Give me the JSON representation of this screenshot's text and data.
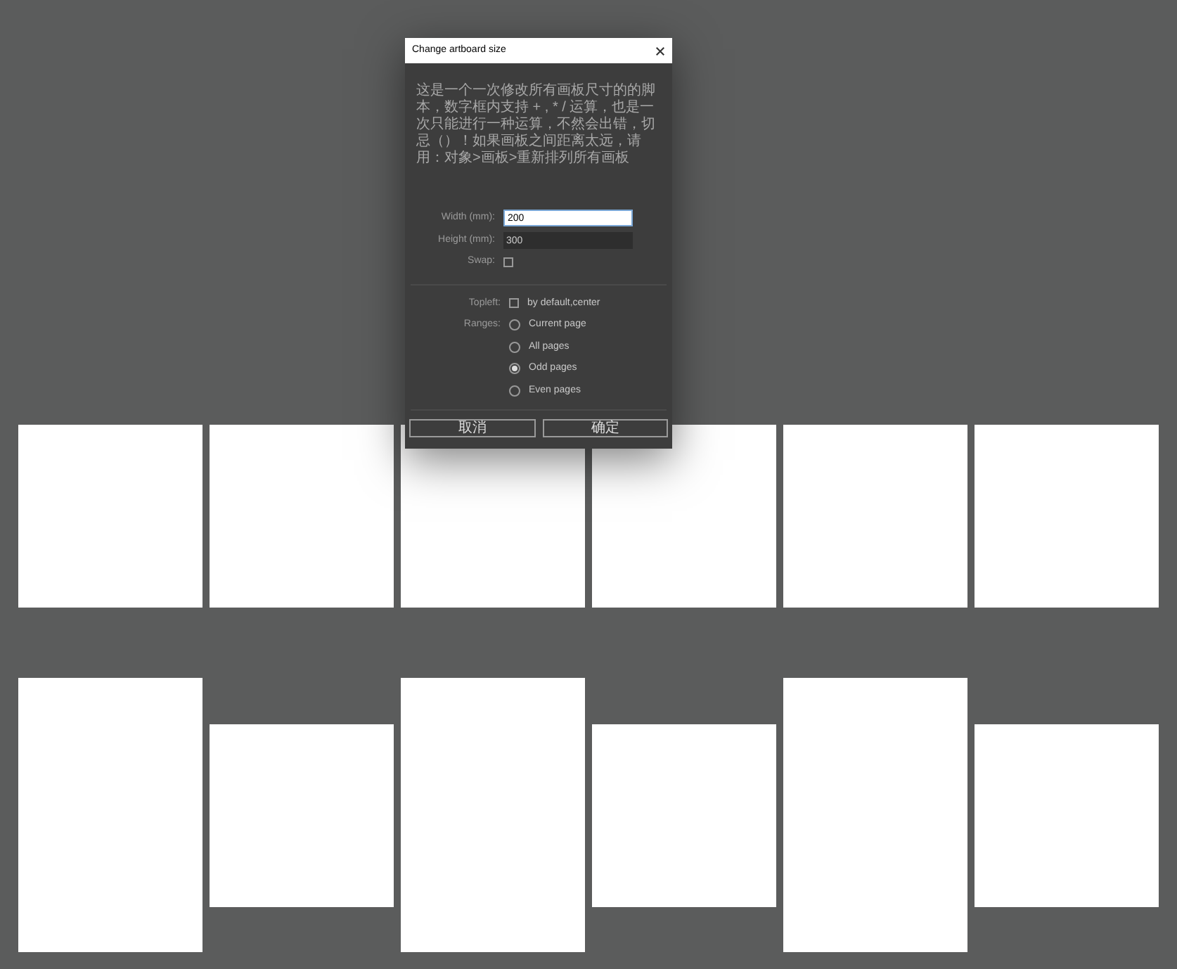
{
  "dialog": {
    "title": "Change artboard size",
    "description": "这是一个一次修改所有画板尺寸的的脚本，数字框内支持 + , * / 运算，也是一次只能进行一种运算，不然会出错，切忌（）！如果画板之间距离太远，请用：对象>画板>重新排列所有画板",
    "width": {
      "label": "Width (mm):",
      "value": "200"
    },
    "height": {
      "label": "Height (mm):",
      "value": "300"
    },
    "swap": {
      "label": "Swap:",
      "checked": false
    },
    "topleft": {
      "label": "Topleft:",
      "option": "by default,center",
      "checked": false
    },
    "ranges": {
      "label": "Ranges:",
      "options": [
        {
          "label": "Current page",
          "selected": false
        },
        {
          "label": "All pages",
          "selected": false
        },
        {
          "label": "Odd pages",
          "selected": true
        },
        {
          "label": "Even pages",
          "selected": false
        }
      ]
    },
    "buttons": [
      "取消",
      "确定"
    ]
  },
  "artboard_rows": [
    {
      "boards": [
        {
          "kind": "square"
        },
        {
          "kind": "square"
        },
        {
          "kind": "square"
        },
        {
          "kind": "square"
        },
        {
          "kind": "square"
        },
        {
          "kind": "square"
        }
      ]
    },
    {
      "boards": [
        {
          "kind": "tall"
        },
        {
          "kind": "wide"
        },
        {
          "kind": "tall"
        },
        {
          "kind": "wide"
        },
        {
          "kind": "tall"
        },
        {
          "kind": "wide"
        }
      ]
    }
  ]
}
